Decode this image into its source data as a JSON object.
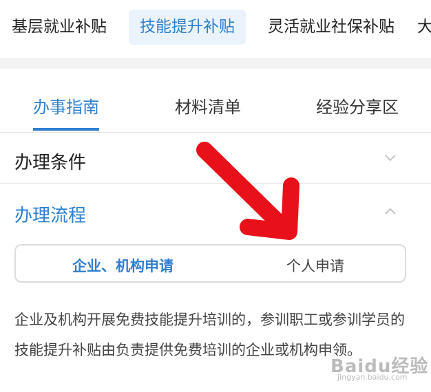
{
  "category_tabs": [
    {
      "label": "基层就业补贴"
    },
    {
      "label": "技能提升补贴",
      "active": true
    },
    {
      "label": "灵活就业社保补贴"
    },
    {
      "label": "大"
    }
  ],
  "sub_tabs": [
    {
      "label": "办事指南",
      "active": true
    },
    {
      "label": "材料清单"
    },
    {
      "label": "经验分享区"
    }
  ],
  "sections": {
    "conditions": {
      "title": "办理条件",
      "expanded": false
    },
    "process": {
      "title": "办理流程",
      "expanded": true
    }
  },
  "segment": {
    "options": [
      "企业、机构申请",
      "个人申请"
    ],
    "selected": 0
  },
  "description": "企业及机构开展免费技能提升培训的，参训职工或参训学员的技能提升补贴由负责提供免费培训的企业或机构申领。",
  "watermark": {
    "logo": "Baidu经验",
    "url": "jingyan.baidu.com"
  },
  "colors": {
    "accent": "#2f7fd0",
    "arrow": "#e8111a",
    "active_tab_bg": "#eaf3fc"
  }
}
